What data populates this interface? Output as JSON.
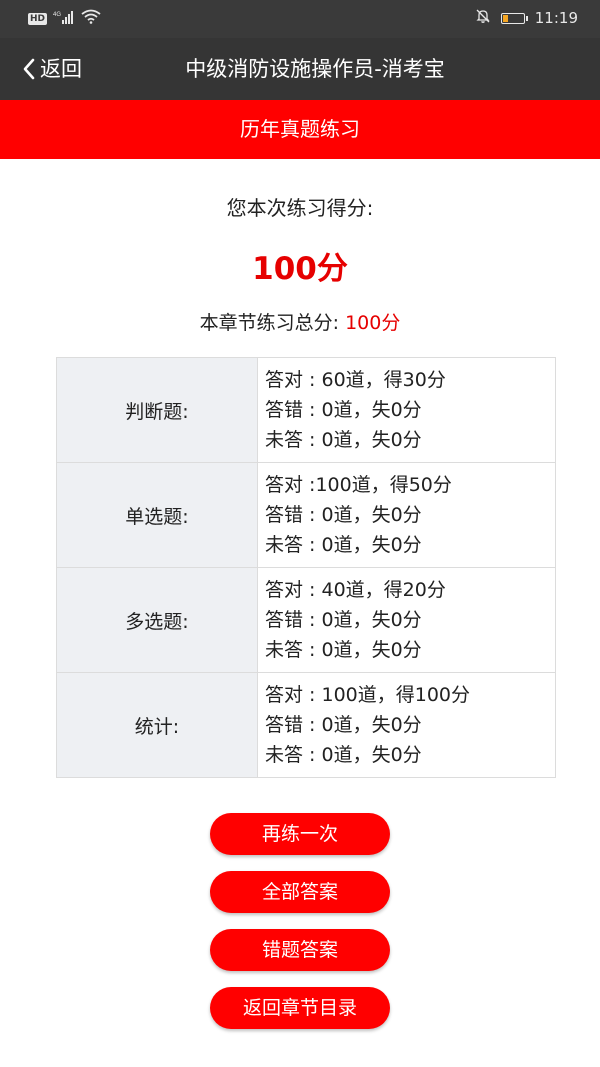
{
  "status_bar": {
    "network_badge": "HD",
    "network_type": "4G",
    "time": "11:19",
    "battery_color": "#f5a623"
  },
  "header": {
    "back_label": "返回",
    "title": "中级消防设施操作员-消考宝"
  },
  "banner": {
    "title": "历年真题练习"
  },
  "score": {
    "caption": "您本次练习得分:",
    "value": "100分",
    "total_label": "本章节练习总分:",
    "total_value": "100分"
  },
  "table": {
    "rows": [
      {
        "category": "判断题:",
        "lines": [
          "答对 : 60道，得30分",
          "答错 : 0道，失0分",
          "未答 : 0道，失0分"
        ]
      },
      {
        "category": "单选题:",
        "lines": [
          "答对 :100道，得50分",
          "答错 : 0道，失0分",
          "未答 : 0道，失0分"
        ]
      },
      {
        "category": "多选题:",
        "lines": [
          "答对 : 40道，得20分",
          "答错 : 0道，失0分",
          "未答 : 0道，失0分"
        ]
      },
      {
        "category": "统计:",
        "lines": [
          "答对 : 100道，得100分",
          "答错 : 0道，失0分",
          "未答 : 0道，失0分"
        ]
      }
    ]
  },
  "buttons": {
    "retry": "再练一次",
    "all_answers": "全部答案",
    "wrong_answers": "错题答案",
    "back_to_chapters": "返回章节目录"
  },
  "colors": {
    "accent_red": "#ff0000",
    "score_red": "#e60000",
    "header_dark": "#353535"
  }
}
